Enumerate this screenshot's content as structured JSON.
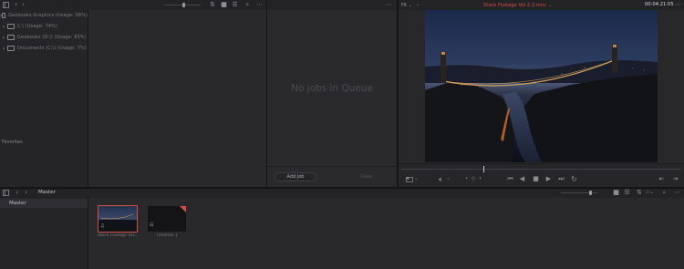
{
  "media_storage": {
    "locations": [
      {
        "label": "Geobooks Graphics (Usage: 58%)"
      },
      {
        "label": "C:\\ (Usage: 74%)"
      },
      {
        "label": "Geobooks (D:\\) (Usage: 83%)"
      },
      {
        "label": "Documents (C:\\) (Usage: 7%)"
      }
    ],
    "favorites_label": "Favorites"
  },
  "render_queue": {
    "empty_message": "No jobs in Queue",
    "add_job_label": "Add Job",
    "clear_label": "Clear"
  },
  "viewer": {
    "fit_label": "Fit",
    "clip_title": "Stock Footage Vol 2.2.mov",
    "timecode": "00:04:21:05",
    "jog_label": "• ◇ •"
  },
  "media_pool": {
    "bin_title": "Master",
    "bins": [
      {
        "label": "Master"
      }
    ],
    "clips": [
      {
        "label": "Stock Footage Vol..."
      },
      {
        "label": "Timeline 1"
      }
    ]
  },
  "colors": {
    "accent_red": "#d64f45",
    "panel_bg": "#28282b",
    "toolbar_bg": "#232326",
    "text": "#8a8a8e"
  }
}
